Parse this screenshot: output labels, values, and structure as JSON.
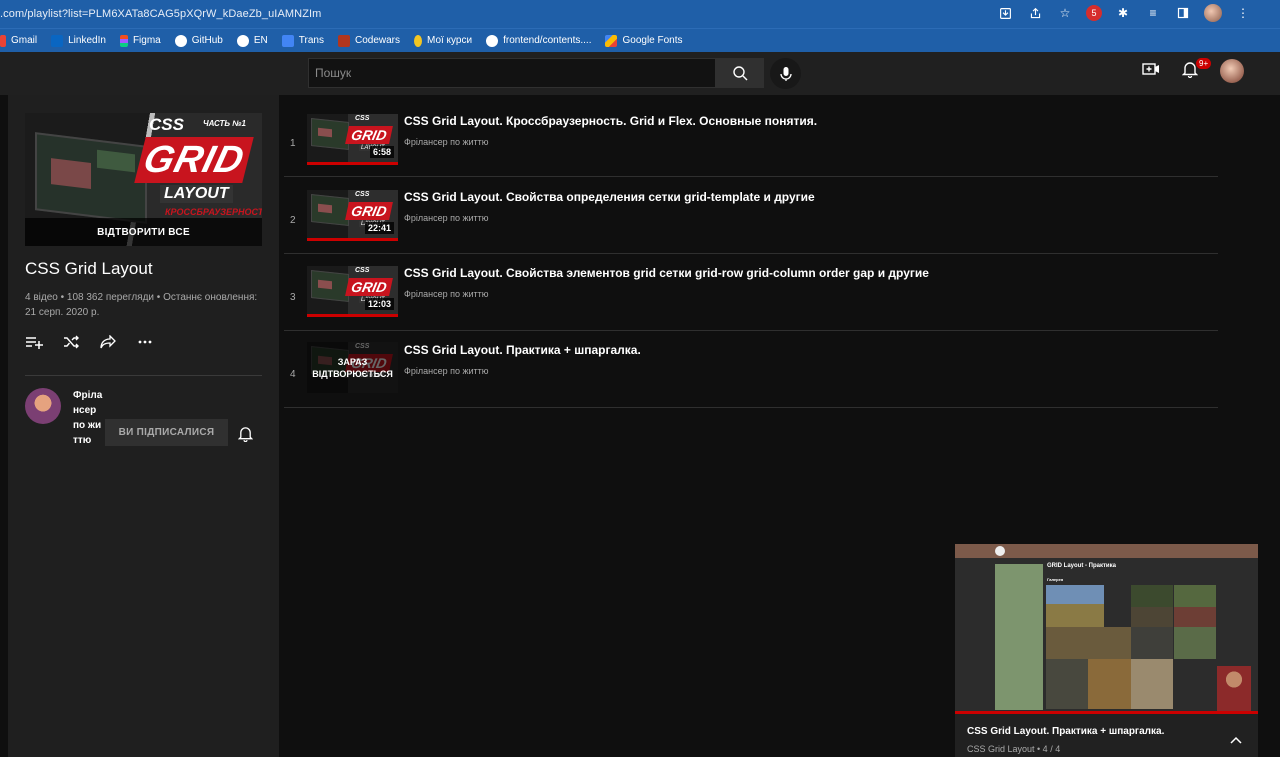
{
  "browser": {
    "url": ".com/playlist?list=PLM6XATa8CAG5pXQrW_kDaeZb_uIAMNZIm",
    "extension_badge": "5"
  },
  "bookmarks": [
    {
      "label": "Gmail",
      "color": "#ea4335"
    },
    {
      "label": "LinkedIn",
      "color": "#0a66c2"
    },
    {
      "label": "Figma",
      "color": "#f24e1e"
    },
    {
      "label": "GitHub",
      "color": "#ffffff"
    },
    {
      "label": "EN",
      "color": "#ffffff"
    },
    {
      "label": "Trans",
      "color": "#4285f4"
    },
    {
      "label": "Codewars",
      "color": "#b1361e"
    },
    {
      "label": "Мої курси",
      "color": "#f3c623"
    },
    {
      "label": "frontend/contents....",
      "color": "#ffffff"
    },
    {
      "label": "Google Fonts",
      "color": "#fbbc04"
    }
  ],
  "topbar": {
    "search_placeholder": "Пошук",
    "notifications_badge": "9+"
  },
  "playlist": {
    "thumb_css": "CSS",
    "thumb_part": "ЧАСТЬ №1",
    "thumb_grid": "GRID",
    "thumb_layout": "LAYOUT",
    "thumb_sub": "КРОССБРАУЗЕРНОСТЬ",
    "play_all": "ВІДТВОРИТИ ВСЕ",
    "title": "CSS Grid Layout",
    "meta": "4 відео • 108 362 перегляди • Останнє оновлення: 21 серп. 2020 р.",
    "channel_name": "Фрілансер по життю",
    "subscribe_label": "ВИ ПІДПИСАЛИСЯ"
  },
  "thumb_text": {
    "css": "CSS",
    "grid": "GRID",
    "layout": "LAYOUT"
  },
  "videos": [
    {
      "index": "1",
      "title": "CSS Grid Layout. Кроссбраузерность. Grid и Flex. Основные понятия.",
      "channel": "Фрілансер по життю",
      "duration": "6:58"
    },
    {
      "index": "2",
      "title": "CSS Grid Layout. Свойства определения сетки grid-template и другие",
      "channel": "Фрілансер по життю",
      "duration": "22:41"
    },
    {
      "index": "3",
      "title": "CSS Grid Layout. Свойства элементов grid сетки grid-row grid-column order gap и другие",
      "channel": "Фрілансер по життю",
      "duration": "12:03"
    },
    {
      "index": "4",
      "title": "CSS Grid Layout. Практика + шпаргалка.",
      "channel": "Фрілансер по життю",
      "now_playing": "ЗАРАЗ ВІДТВОРЮЄТЬСЯ"
    }
  ],
  "miniplayer": {
    "page_heading": "GRID Layout - Практика",
    "gallery_label": "Галерея",
    "title": "CSS Grid Layout. Практика + шпаргалка.",
    "subtitle": "CSS Grid Layout • 4 / 4"
  },
  "colors": {
    "accent_red": "#cc0000",
    "browser_blue": "#1f5fa8",
    "yt_bg": "#0f0f0f"
  }
}
